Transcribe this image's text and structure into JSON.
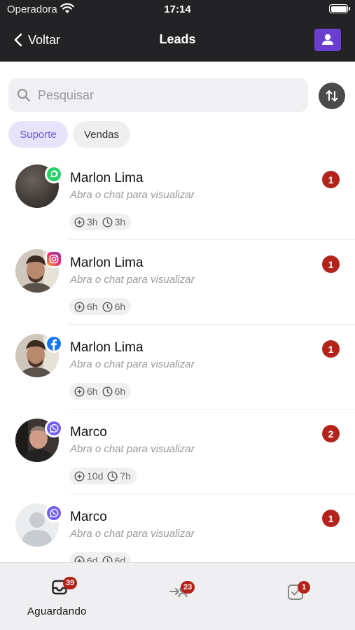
{
  "status_bar": {
    "carrier": "Operadora",
    "time": "17:14"
  },
  "nav": {
    "back_label": "Voltar",
    "title": "Leads",
    "accent": "#6a3fd0"
  },
  "search": {
    "placeholder": "Pesquisar",
    "value": ""
  },
  "filters": [
    {
      "label": "Suporte",
      "selected": true
    },
    {
      "label": "Vendas",
      "selected": false
    }
  ],
  "leads": [
    {
      "name": "Marlon Lima",
      "preview": "Abra o chat para visualizar",
      "channel": "whatsapp-icon",
      "unread": "1",
      "created": "3h",
      "waiting": "3h"
    },
    {
      "name": "Marlon Lima",
      "preview": "Abra o chat para visualizar",
      "channel": "instagram-icon",
      "unread": "1",
      "created": "6h",
      "waiting": "6h"
    },
    {
      "name": "Marlon Lima",
      "preview": "Abra o chat para visualizar",
      "channel": "facebook-icon",
      "unread": "1",
      "created": "6h",
      "waiting": "6h"
    },
    {
      "name": "Marco",
      "preview": "Abra o chat para visualizar",
      "channel": "viber-icon",
      "unread": "2",
      "created": "10d",
      "waiting": "7h"
    },
    {
      "name": "Marco",
      "preview": "Abra o chat para visualizar",
      "channel": "viber-icon",
      "unread": "1",
      "created": "6d",
      "waiting": "6d"
    }
  ],
  "tabs": [
    {
      "label": "Aguardando",
      "badge": "39",
      "icon": "inbox-icon",
      "active": true
    },
    {
      "label": "",
      "badge": "23",
      "icon": "transfer-icon",
      "active": false
    },
    {
      "label": "",
      "badge": "1",
      "icon": "check-inbox-icon",
      "active": false
    }
  ],
  "colors": {
    "unread_badge": "#b3231b",
    "header_bg": "#232325",
    "chip_selected_bg": "#e6e3fb",
    "chip_selected_text": "#6b56d9"
  }
}
